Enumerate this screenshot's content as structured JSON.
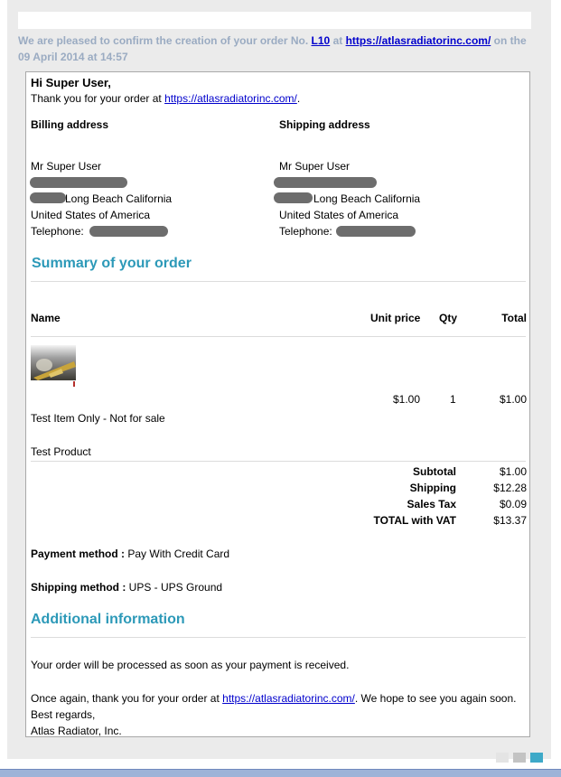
{
  "header": {
    "confirm_prefix": "We are pleased to confirm the creation of your order No.",
    "order_no": "L10",
    "at": "at",
    "site_url": "https://atlasradiatorinc.com/",
    "on_the": "on the",
    "date": "09 April 2014 at 14:57"
  },
  "greeting": {
    "hi": "Hi Super User,",
    "thanks_prefix": "Thank you for your order at",
    "url": "https://atlasradiatorinc.com/",
    "thanks_suffix": "."
  },
  "billing": {
    "title": "Billing address",
    "name": "Mr Super User",
    "city": "Long Beach California",
    "country": "United States of America",
    "tel_label": "Telephone:"
  },
  "shipping": {
    "title": "Shipping address",
    "name": "Mr Super User",
    "city": "Long Beach California",
    "country": "United States of America",
    "tel_label": "Telephone:"
  },
  "summary": {
    "title": "Summary of your order",
    "columns": {
      "name": "Name",
      "unit_price": "Unit price",
      "qty": "Qty",
      "total": "Total"
    },
    "item": {
      "unit_price": "$1.00",
      "qty": "1",
      "total": "$1.00",
      "line1": "Test Item Only - Not for sale",
      "line2": "Test Product"
    },
    "totals": [
      {
        "label": "Subtotal",
        "value": "$1.00"
      },
      {
        "label": "Shipping",
        "value": "$12.28"
      },
      {
        "label": "Sales Tax",
        "value": "$0.09"
      },
      {
        "label": "TOTAL with VAT",
        "value": "$13.37"
      }
    ]
  },
  "payment": {
    "label": "Payment method :",
    "value": "Pay With Credit Card"
  },
  "shipping_method": {
    "label": "Shipping method :",
    "value": "UPS - UPS Ground"
  },
  "additional": {
    "title": "Additional information",
    "processed": "Your order will be processed as soon as your payment is received.",
    "again_prefix": "Once again, thank you for your order at",
    "again_url": "https://atlasradiatorinc.com/",
    "again_suffix": ". We hope to see you again soon.",
    "regards": "Best regards,",
    "company": "Atlas Radiator, Inc."
  },
  "colors": {
    "accent": "#2c99b8",
    "confirm_text": "#9aabc2",
    "link": "#0000cc",
    "redaction": "#6d6d6d"
  }
}
